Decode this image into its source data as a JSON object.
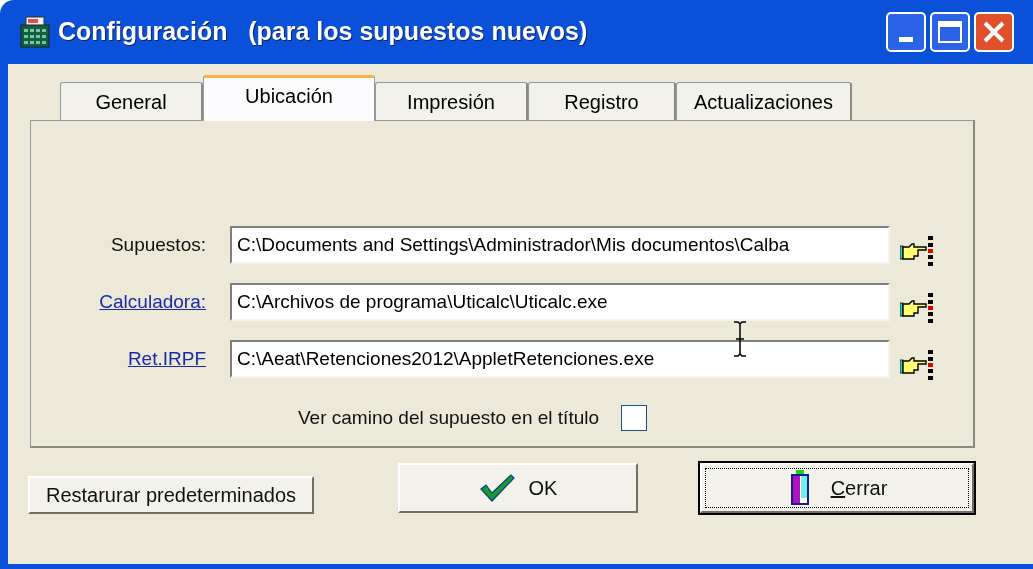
{
  "window": {
    "title": "Configuración   (para los supuestos nuevos)"
  },
  "tabs": [
    {
      "label": "General",
      "selected": false
    },
    {
      "label": "Ubicación",
      "selected": true
    },
    {
      "label": "Impresión",
      "selected": false
    },
    {
      "label": "Registro",
      "selected": false
    },
    {
      "label": "Actualizaciones",
      "selected": false
    }
  ],
  "paths": [
    {
      "label": "Supuestos:",
      "kind": "text",
      "value": "C:\\Documents and Settings\\Administrador\\Mis documentos\\Calba"
    },
    {
      "label": "Calculadora:",
      "kind": "link",
      "value": "C:\\Archivos de programa\\Uticalc\\Uticalc.exe"
    },
    {
      "label": "Ret.IRPF",
      "kind": "link",
      "value": "C:\\Aeat\\Retenciones2012\\AppletRetenciones.exe"
    }
  ],
  "show_path_in_title": {
    "label": "Ver camino del supuesto en el título",
    "checked": false
  },
  "buttons": [
    {
      "kind": "restore",
      "label": "Restarurar predeterminados"
    },
    {
      "kind": "ok",
      "label": "OK"
    },
    {
      "kind": "close",
      "label": "Cerrar",
      "mnemonic": true,
      "default": true
    }
  ]
}
